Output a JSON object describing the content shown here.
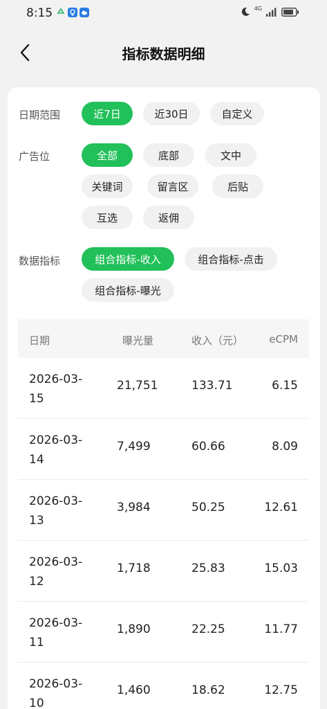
{
  "status_bar": {
    "time": "8:15",
    "network": "4G",
    "icon_colors": [
      "#2ab36b",
      "#2a7de1",
      "#2a7de1"
    ]
  },
  "header": {
    "title": "指标数据明细"
  },
  "filters": {
    "date_range": {
      "label": "日期范围",
      "options": [
        "近7日",
        "近30日",
        "自定义"
      ],
      "selected": "近7日"
    },
    "ad_slot": {
      "label": "广告位",
      "options": [
        "全部",
        "底部",
        "文中",
        "关键词",
        "留言区",
        "后贴",
        "互选",
        "返佣"
      ],
      "selected": "全部"
    },
    "metric": {
      "label": "数据指标",
      "options": [
        "组合指标-收入",
        "组合指标-点击",
        "组合指标-曝光"
      ],
      "selected": "组合指标-收入"
    }
  },
  "table": {
    "headers": [
      "日期",
      "曝光量",
      "收入（元）",
      "eCPM"
    ],
    "rows": [
      {
        "date": "2026-03-\n15",
        "exposure": "21,751",
        "income": "133.71",
        "ecpm": "6.15"
      },
      {
        "date": "2026-03-\n14",
        "exposure": "7,499",
        "income": "60.66",
        "ecpm": "8.09"
      },
      {
        "date": "2026-03-\n13",
        "exposure": "3,984",
        "income": "50.25",
        "ecpm": "12.61"
      },
      {
        "date": "2026-03-\n12",
        "exposure": "1,718",
        "income": "25.83",
        "ecpm": "15.03"
      },
      {
        "date": "2026-03-\n11",
        "exposure": "1,890",
        "income": "22.25",
        "ecpm": "11.77"
      },
      {
        "date": "2026-03-\n10",
        "exposure": "1,460",
        "income": "18.62",
        "ecpm": "12.75"
      }
    ]
  },
  "colors": {
    "accent": "#22c05a",
    "background": "#f2f2f2"
  }
}
